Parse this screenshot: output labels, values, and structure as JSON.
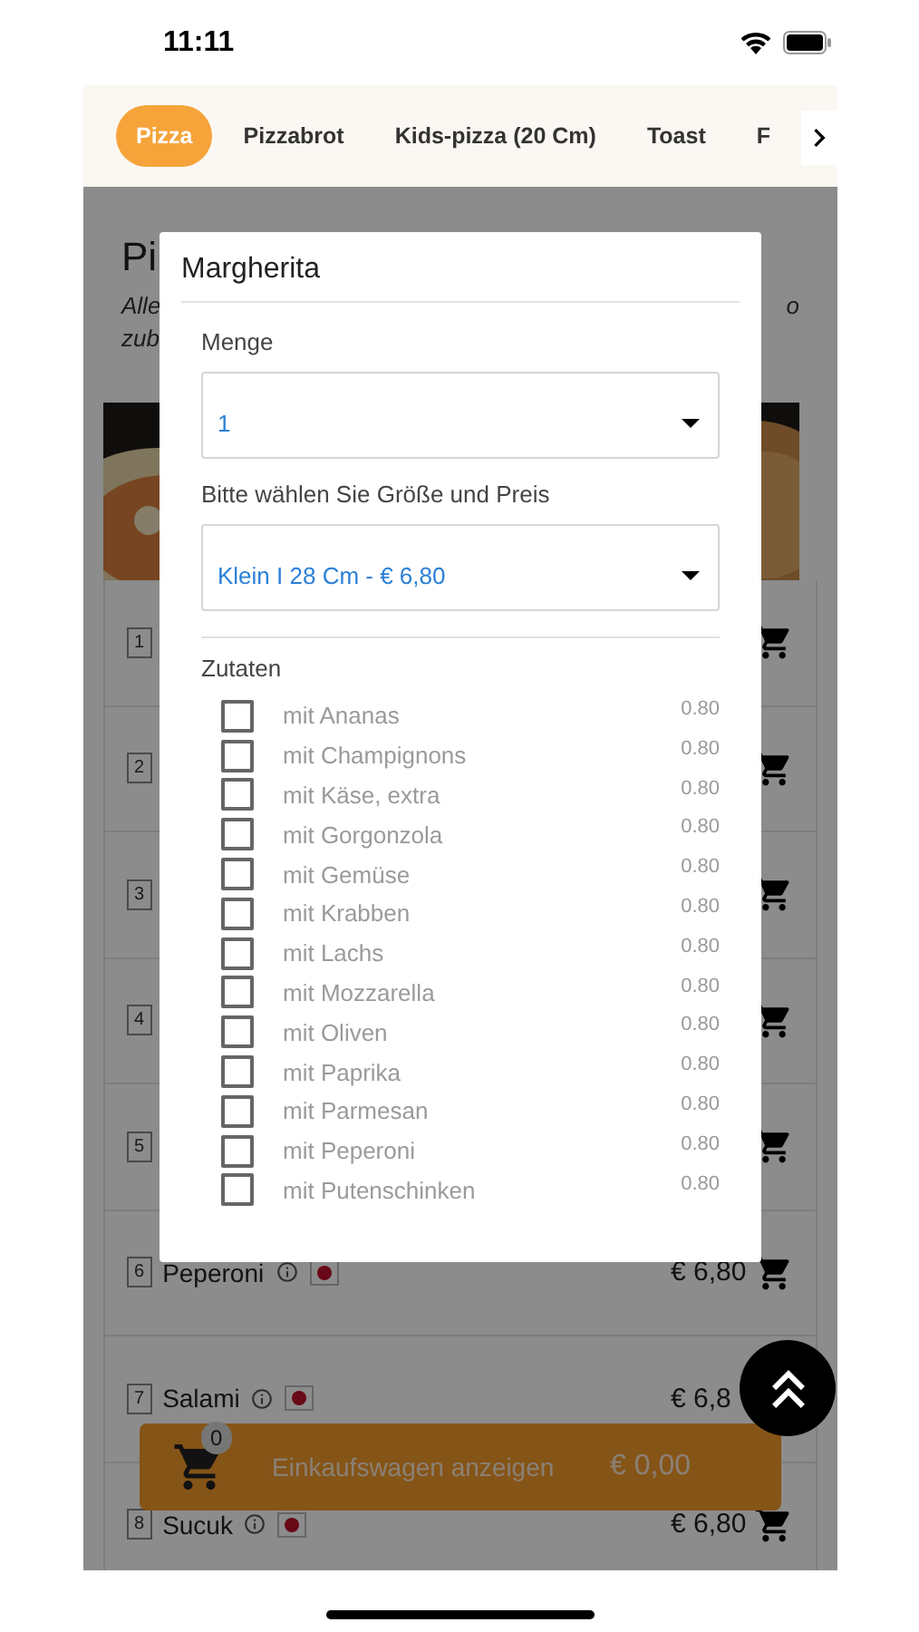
{
  "status_bar": {
    "time": "11:11"
  },
  "tabs": [
    {
      "label": "Pizza",
      "selected": true
    },
    {
      "label": "Pizzabrot",
      "selected": false
    },
    {
      "label": "Kids-pizza (20 Cm)",
      "selected": false
    },
    {
      "label": "Toast",
      "selected": false
    },
    {
      "label": "F",
      "selected": false
    }
  ],
  "category": {
    "title": "Pi",
    "description_lines": [
      "Alle",
      "zub"
    ],
    "description_tail": "o"
  },
  "items": [
    {
      "kind": "cart",
      "number": "1"
    },
    {
      "kind": "cart",
      "number": "2"
    },
    {
      "kind": "cart",
      "number": "3"
    },
    {
      "kind": "cart",
      "number": "4"
    },
    {
      "kind": "cart",
      "number": "5"
    },
    {
      "kind": "cart",
      "number": "6",
      "name": "Peperoni",
      "price": "€ 6,80"
    },
    {
      "kind": "plain",
      "number": "7",
      "name": "Salami",
      "price": "€ 6,8"
    },
    {
      "kind": "cart",
      "number": "8",
      "name": "Sucuk",
      "price": "€ 6,80"
    }
  ],
  "dialog": {
    "title": "Margherita",
    "quantity": {
      "label": "Menge",
      "value": "1"
    },
    "size": {
      "label": "Bitte wählen Sie Größe und Preis",
      "value": "Klein I 28 Cm - € 6,80"
    },
    "extras_label": "Zutaten",
    "extras": [
      {
        "name": "mit Ananas",
        "price": "0.80",
        "checked": false
      },
      {
        "name": "mit Champignons",
        "price": "0.80",
        "checked": false
      },
      {
        "name": "mit Käse, extra",
        "price": "0.80",
        "checked": false
      },
      {
        "name": "mit Gorgonzola",
        "price": "0.80",
        "checked": false
      },
      {
        "name": "mit Gemüse",
        "price": "0.80",
        "checked": false
      },
      {
        "name": "mit Krabben",
        "price": "0.80",
        "checked": false
      },
      {
        "name": "mit Lachs",
        "price": "0.80",
        "checked": false
      },
      {
        "name": "mit Mozzarella",
        "price": "0.80",
        "checked": false
      },
      {
        "name": "mit Oliven",
        "price": "0.80",
        "checked": false
      },
      {
        "name": "mit Paprika",
        "price": "0.80",
        "checked": false
      },
      {
        "name": "mit Parmesan",
        "price": "0.80",
        "checked": false
      },
      {
        "name": "mit Peperoni",
        "price": "0.80",
        "checked": false
      },
      {
        "name": "mit Putenschinken",
        "price": "0.80",
        "checked": false
      }
    ]
  },
  "cart": {
    "count": "0",
    "label": "Einkaufswagen anzeigen",
    "total": "€ 0,00"
  }
}
